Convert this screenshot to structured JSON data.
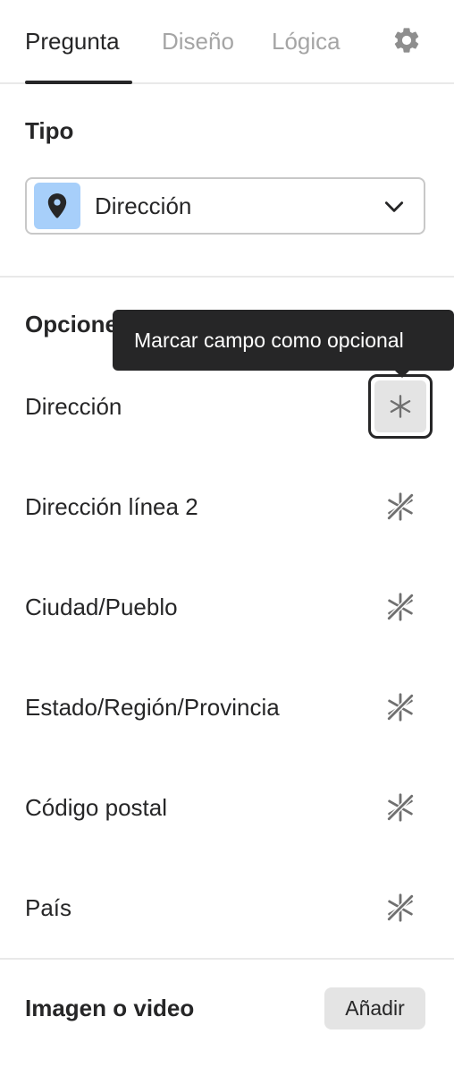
{
  "tabs": [
    {
      "label": "Pregunta",
      "active": true
    },
    {
      "label": "Diseño",
      "active": false
    },
    {
      "label": "Lógica",
      "active": false
    }
  ],
  "settings_icon": "gear-icon",
  "type_section": {
    "title": "Tipo",
    "selected": "Dirección",
    "icon": "location-pin-icon",
    "icon_bg": "#a7cffa"
  },
  "options_section": {
    "title": "Opciones",
    "fields": [
      {
        "label": "Dirección",
        "required": true
      },
      {
        "label": "Dirección línea 2",
        "required": false
      },
      {
        "label": "Ciudad/Pueblo",
        "required": false
      },
      {
        "label": "Estado/Región/Provincia",
        "required": false
      },
      {
        "label": "Código postal",
        "required": false
      },
      {
        "label": "País",
        "required": false
      }
    ],
    "tooltip": "Marcar campo como opcional"
  },
  "media_section": {
    "title": "Imagen o video",
    "add_label": "Añadir"
  }
}
